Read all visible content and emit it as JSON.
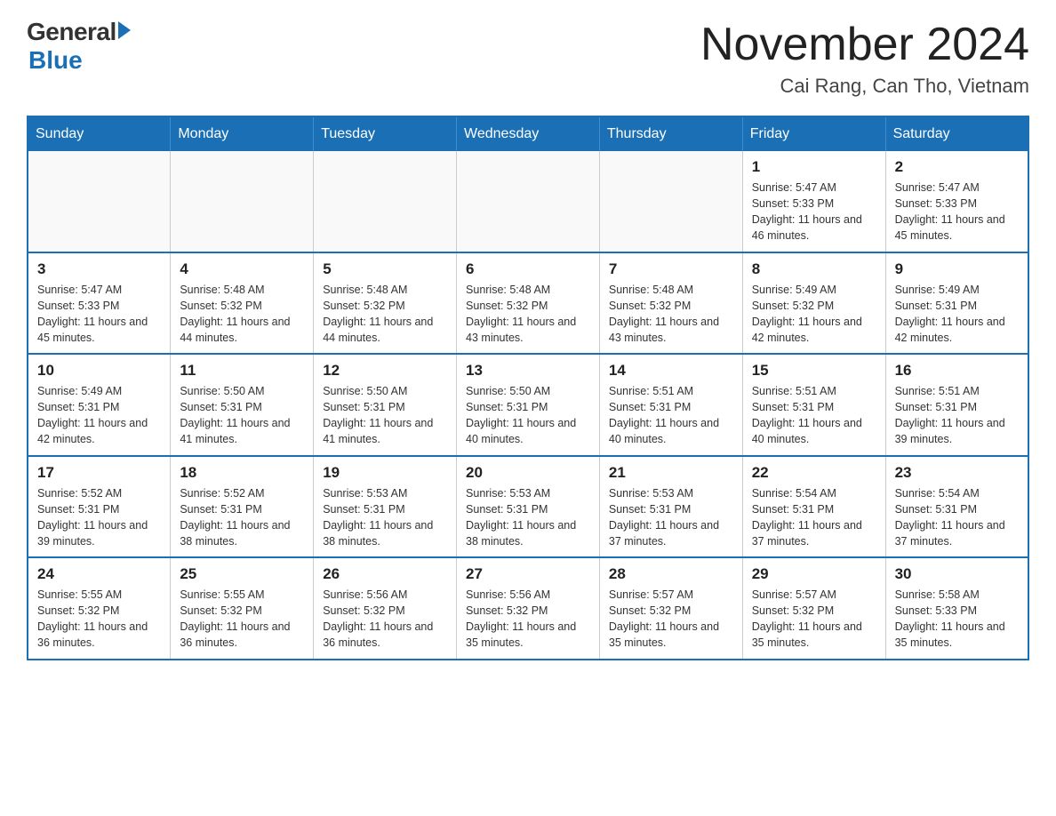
{
  "header": {
    "logo_general": "General",
    "logo_blue": "Blue",
    "title": "November 2024",
    "location": "Cai Rang, Can Tho, Vietnam"
  },
  "days_of_week": [
    "Sunday",
    "Monday",
    "Tuesday",
    "Wednesday",
    "Thursday",
    "Friday",
    "Saturday"
  ],
  "weeks": [
    [
      {
        "day": "",
        "info": ""
      },
      {
        "day": "",
        "info": ""
      },
      {
        "day": "",
        "info": ""
      },
      {
        "day": "",
        "info": ""
      },
      {
        "day": "",
        "info": ""
      },
      {
        "day": "1",
        "info": "Sunrise: 5:47 AM\nSunset: 5:33 PM\nDaylight: 11 hours and 46 minutes."
      },
      {
        "day": "2",
        "info": "Sunrise: 5:47 AM\nSunset: 5:33 PM\nDaylight: 11 hours and 45 minutes."
      }
    ],
    [
      {
        "day": "3",
        "info": "Sunrise: 5:47 AM\nSunset: 5:33 PM\nDaylight: 11 hours and 45 minutes."
      },
      {
        "day": "4",
        "info": "Sunrise: 5:48 AM\nSunset: 5:32 PM\nDaylight: 11 hours and 44 minutes."
      },
      {
        "day": "5",
        "info": "Sunrise: 5:48 AM\nSunset: 5:32 PM\nDaylight: 11 hours and 44 minutes."
      },
      {
        "day": "6",
        "info": "Sunrise: 5:48 AM\nSunset: 5:32 PM\nDaylight: 11 hours and 43 minutes."
      },
      {
        "day": "7",
        "info": "Sunrise: 5:48 AM\nSunset: 5:32 PM\nDaylight: 11 hours and 43 minutes."
      },
      {
        "day": "8",
        "info": "Sunrise: 5:49 AM\nSunset: 5:32 PM\nDaylight: 11 hours and 42 minutes."
      },
      {
        "day": "9",
        "info": "Sunrise: 5:49 AM\nSunset: 5:31 PM\nDaylight: 11 hours and 42 minutes."
      }
    ],
    [
      {
        "day": "10",
        "info": "Sunrise: 5:49 AM\nSunset: 5:31 PM\nDaylight: 11 hours and 42 minutes."
      },
      {
        "day": "11",
        "info": "Sunrise: 5:50 AM\nSunset: 5:31 PM\nDaylight: 11 hours and 41 minutes."
      },
      {
        "day": "12",
        "info": "Sunrise: 5:50 AM\nSunset: 5:31 PM\nDaylight: 11 hours and 41 minutes."
      },
      {
        "day": "13",
        "info": "Sunrise: 5:50 AM\nSunset: 5:31 PM\nDaylight: 11 hours and 40 minutes."
      },
      {
        "day": "14",
        "info": "Sunrise: 5:51 AM\nSunset: 5:31 PM\nDaylight: 11 hours and 40 minutes."
      },
      {
        "day": "15",
        "info": "Sunrise: 5:51 AM\nSunset: 5:31 PM\nDaylight: 11 hours and 40 minutes."
      },
      {
        "day": "16",
        "info": "Sunrise: 5:51 AM\nSunset: 5:31 PM\nDaylight: 11 hours and 39 minutes."
      }
    ],
    [
      {
        "day": "17",
        "info": "Sunrise: 5:52 AM\nSunset: 5:31 PM\nDaylight: 11 hours and 39 minutes."
      },
      {
        "day": "18",
        "info": "Sunrise: 5:52 AM\nSunset: 5:31 PM\nDaylight: 11 hours and 38 minutes."
      },
      {
        "day": "19",
        "info": "Sunrise: 5:53 AM\nSunset: 5:31 PM\nDaylight: 11 hours and 38 minutes."
      },
      {
        "day": "20",
        "info": "Sunrise: 5:53 AM\nSunset: 5:31 PM\nDaylight: 11 hours and 38 minutes."
      },
      {
        "day": "21",
        "info": "Sunrise: 5:53 AM\nSunset: 5:31 PM\nDaylight: 11 hours and 37 minutes."
      },
      {
        "day": "22",
        "info": "Sunrise: 5:54 AM\nSunset: 5:31 PM\nDaylight: 11 hours and 37 minutes."
      },
      {
        "day": "23",
        "info": "Sunrise: 5:54 AM\nSunset: 5:31 PM\nDaylight: 11 hours and 37 minutes."
      }
    ],
    [
      {
        "day": "24",
        "info": "Sunrise: 5:55 AM\nSunset: 5:32 PM\nDaylight: 11 hours and 36 minutes."
      },
      {
        "day": "25",
        "info": "Sunrise: 5:55 AM\nSunset: 5:32 PM\nDaylight: 11 hours and 36 minutes."
      },
      {
        "day": "26",
        "info": "Sunrise: 5:56 AM\nSunset: 5:32 PM\nDaylight: 11 hours and 36 minutes."
      },
      {
        "day": "27",
        "info": "Sunrise: 5:56 AM\nSunset: 5:32 PM\nDaylight: 11 hours and 35 minutes."
      },
      {
        "day": "28",
        "info": "Sunrise: 5:57 AM\nSunset: 5:32 PM\nDaylight: 11 hours and 35 minutes."
      },
      {
        "day": "29",
        "info": "Sunrise: 5:57 AM\nSunset: 5:32 PM\nDaylight: 11 hours and 35 minutes."
      },
      {
        "day": "30",
        "info": "Sunrise: 5:58 AM\nSunset: 5:33 PM\nDaylight: 11 hours and 35 minutes."
      }
    ]
  ]
}
